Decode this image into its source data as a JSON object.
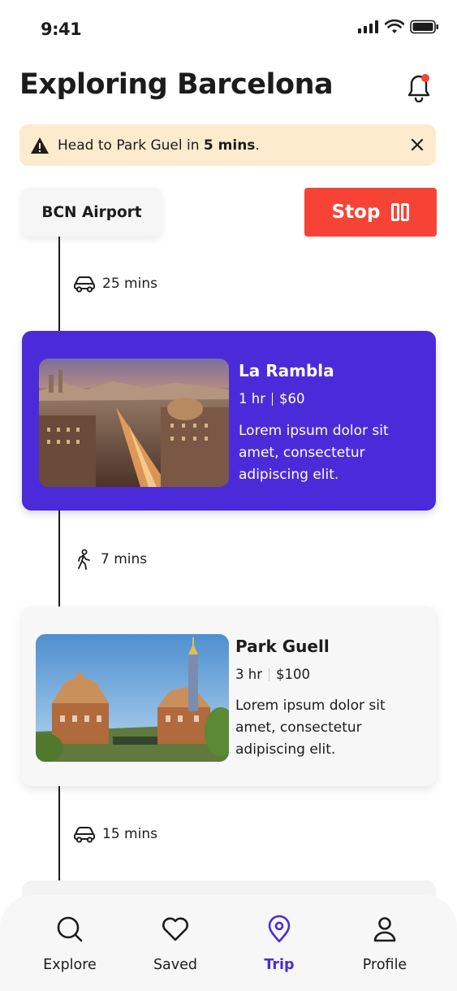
{
  "status": {
    "time": "9:41"
  },
  "header": {
    "title": "Exploring Barcelona"
  },
  "alert": {
    "prefix": "Head to Park Guel in ",
    "bold": "5 mins",
    "suffix": "."
  },
  "origin": {
    "label": "BCN Airport"
  },
  "stop_button": {
    "label": "Stop"
  },
  "legs": [
    {
      "mode": "car",
      "duration": "25 mins"
    },
    {
      "mode": "walk",
      "duration": "7 mins"
    },
    {
      "mode": "car",
      "duration": "15 mins"
    }
  ],
  "stops": [
    {
      "name": "La Rambla",
      "duration": "1 hr",
      "price": "$60",
      "description": "Lorem ipsum dolor sit amet, consectetur adipiscing elit.",
      "active": true
    },
    {
      "name": "Park Guell",
      "duration": "3 hr",
      "price": "$100",
      "description": "Lorem ipsum dolor sit amet, consectetur adipiscing elit.",
      "active": false
    }
  ],
  "nav": {
    "items": [
      {
        "label": "Explore",
        "icon": "search-icon"
      },
      {
        "label": "Saved",
        "icon": "heart-icon"
      },
      {
        "label": "Trip",
        "icon": "location-pin-icon"
      },
      {
        "label": "Profile",
        "icon": "user-icon"
      }
    ],
    "active": "Trip"
  },
  "colors": {
    "accent": "#4b2bd9",
    "stop": "#f74336",
    "alert_bg": "#fdebcd",
    "notification_dot": "#f74336"
  }
}
